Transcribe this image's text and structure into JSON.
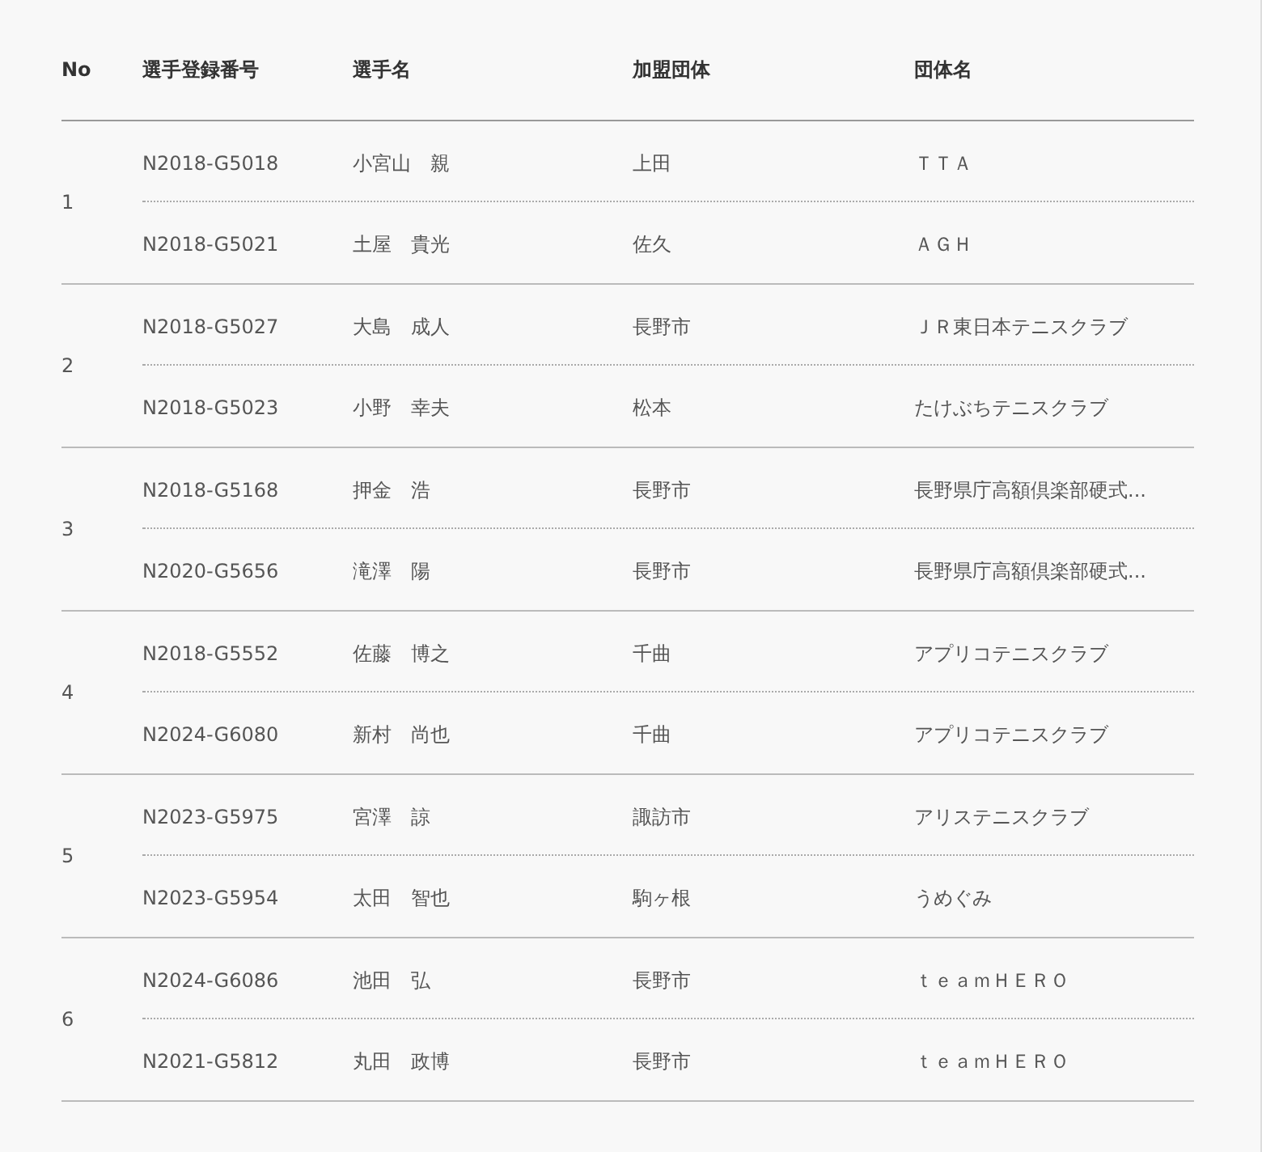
{
  "table": {
    "columns": [
      "No",
      "選手登録番号",
      "選手名",
      "加盟団体",
      "団体名"
    ],
    "groups": [
      {
        "no": "1",
        "players": [
          {
            "reg": "N2018-G5018",
            "name": "小宮山　親",
            "assoc": "上田",
            "team": "ＴＴＡ"
          },
          {
            "reg": "N2018-G5021",
            "name": "土屋　貴光",
            "assoc": "佐久",
            "team": "ＡＧＨ"
          }
        ]
      },
      {
        "no": "2",
        "players": [
          {
            "reg": "N2018-G5027",
            "name": "大島　成人",
            "assoc": "長野市",
            "team": "ＪＲ東日本テニスクラブ"
          },
          {
            "reg": "N2018-G5023",
            "name": "小野　幸夫",
            "assoc": "松本",
            "team": "たけぶちテニスクラブ"
          }
        ]
      },
      {
        "no": "3",
        "players": [
          {
            "reg": "N2018-G5168",
            "name": "押金　浩",
            "assoc": "長野市",
            "team": "長野県庁高額倶楽部硬式..."
          },
          {
            "reg": "N2020-G5656",
            "name": "滝澤　陽",
            "assoc": "長野市",
            "team": "長野県庁高額倶楽部硬式..."
          }
        ]
      },
      {
        "no": "4",
        "players": [
          {
            "reg": "N2018-G5552",
            "name": "佐藤　博之",
            "assoc": "千曲",
            "team": "アプリコテニスクラブ"
          },
          {
            "reg": "N2024-G6080",
            "name": "新村　尚也",
            "assoc": "千曲",
            "team": "アプリコテニスクラブ"
          }
        ]
      },
      {
        "no": "5",
        "players": [
          {
            "reg": "N2023-G5975",
            "name": "宮澤　諒",
            "assoc": "諏訪市",
            "team": "アリステニスクラブ"
          },
          {
            "reg": "N2023-G5954",
            "name": "太田　智也",
            "assoc": "駒ヶ根",
            "team": "うめぐみ"
          }
        ]
      },
      {
        "no": "6",
        "players": [
          {
            "reg": "N2024-G6086",
            "name": "池田　弘",
            "assoc": "長野市",
            "team": "ｔｅａｍＨＥＲＯ"
          },
          {
            "reg": "N2021-G5812",
            "name": "丸田　政博",
            "assoc": "長野市",
            "team": "ｔｅａｍＨＥＲＯ"
          }
        ]
      }
    ]
  }
}
